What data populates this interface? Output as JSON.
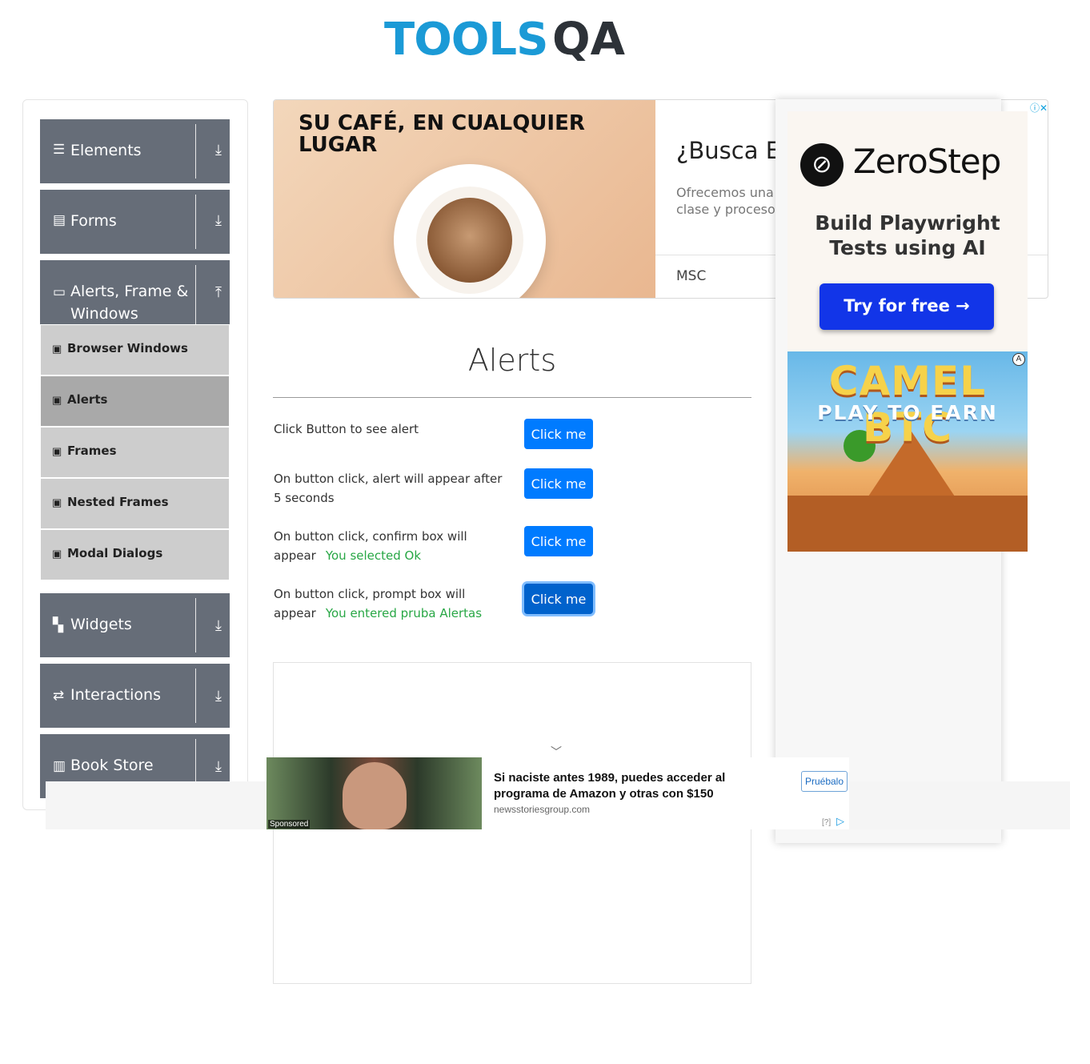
{
  "logo": {
    "text": "TOOLS",
    "suffix": "QA"
  },
  "sidebar": {
    "groups": [
      {
        "label": "Elements",
        "icon": "hamburger-icon",
        "expanded": false
      },
      {
        "label": "Forms",
        "icon": "document-icon",
        "expanded": false
      },
      {
        "label": "Alerts, Frame & Windows",
        "icon": "window-icon",
        "expanded": true
      },
      {
        "label": "Widgets",
        "icon": "widgets-icon",
        "expanded": false
      },
      {
        "label": "Interactions",
        "icon": "interactions-icon",
        "expanded": false
      },
      {
        "label": "Book Store",
        "icon": "bookstore-icon",
        "expanded": false
      }
    ],
    "sub_items": [
      {
        "label": "Browser Windows",
        "active": false
      },
      {
        "label": "Alerts",
        "active": true
      },
      {
        "label": "Frames",
        "active": false
      },
      {
        "label": "Nested Frames",
        "active": false
      },
      {
        "label": "Modal Dialogs",
        "active": false
      }
    ]
  },
  "top_ad": {
    "headline": "SU CAFÉ, EN CUALQUIER LUGAR",
    "title": "¿Busca Ex",
    "description": "Ofrecemos una clase y proceso",
    "advertiser": "MSC"
  },
  "right_ad": {
    "brand": "ZeroStep",
    "tagline": "Build Playwright Tests using AI",
    "cta": "Try for free →",
    "game_title": "CAMEL BTC",
    "game_subtitle": "PLAY TO EARN"
  },
  "main": {
    "title": "Alerts",
    "rows": [
      {
        "text": "Click Button to see alert",
        "button": "Click me",
        "result": ""
      },
      {
        "text": "On button click, alert will appear after 5 seconds",
        "button": "Click me",
        "result": ""
      },
      {
        "text": "On button click, confirm box will appear",
        "button": "Click me",
        "result": "You selected Ok"
      },
      {
        "text": "On button click, prompt box will appear",
        "button": "Click me",
        "result": "You entered pruba Alertas"
      }
    ]
  },
  "bottom_ad": {
    "sponsored_label": "Sponsored",
    "headline": "Si naciste antes 1989, puedes acceder al programa de Amazon y otras con $150",
    "site": "newsstoriesgroup.com",
    "cta": "Pruébalo",
    "info": "[?]"
  },
  "colors": {
    "accent": "#007bff",
    "sidebar_group": "#666d78",
    "sub_item": "#cdcdcd",
    "sub_item_active": "#a9a9a9",
    "result_text": "#28a745"
  }
}
